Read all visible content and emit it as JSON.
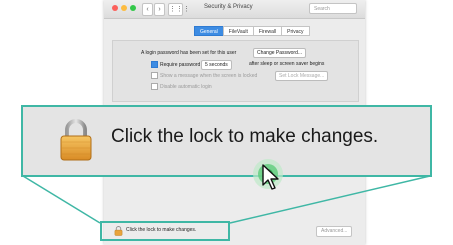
{
  "window": {
    "title": "Security & Privacy",
    "search_placeholder": "Search",
    "nav_back": "‹",
    "nav_forward": "›",
    "nav_grid": "⋮⋮⋮"
  },
  "tabs": [
    {
      "label": "General",
      "active": true
    },
    {
      "label": "FileVault",
      "active": false
    },
    {
      "label": "Firewall",
      "active": false
    },
    {
      "label": "Privacy",
      "active": false
    }
  ],
  "general": {
    "login_password_text": "A login password has been set for this user",
    "change_password_button": "Change Password...",
    "require_password_label": "Require password",
    "require_password_value": "5 seconds",
    "require_password_suffix": "after sleep or screen saver begins",
    "show_message_label": "Show a message when the screen is locked",
    "set_lock_message_button": "Set Lock Message...",
    "disable_auto_login_label": "Disable automatic login"
  },
  "bottom": {
    "lock_text": "Click the lock to make changes.",
    "advanced_button": "Advanced..."
  },
  "zoom": {
    "lock_text": "Click the lock to make changes."
  },
  "colors": {
    "accent": "#3fb7a5",
    "tab_active": "#3d8ce3",
    "lock_gold": "#e9a43c"
  },
  "icons": {
    "lock": "padlock-icon",
    "cursor": "mouse-pointer-icon"
  }
}
